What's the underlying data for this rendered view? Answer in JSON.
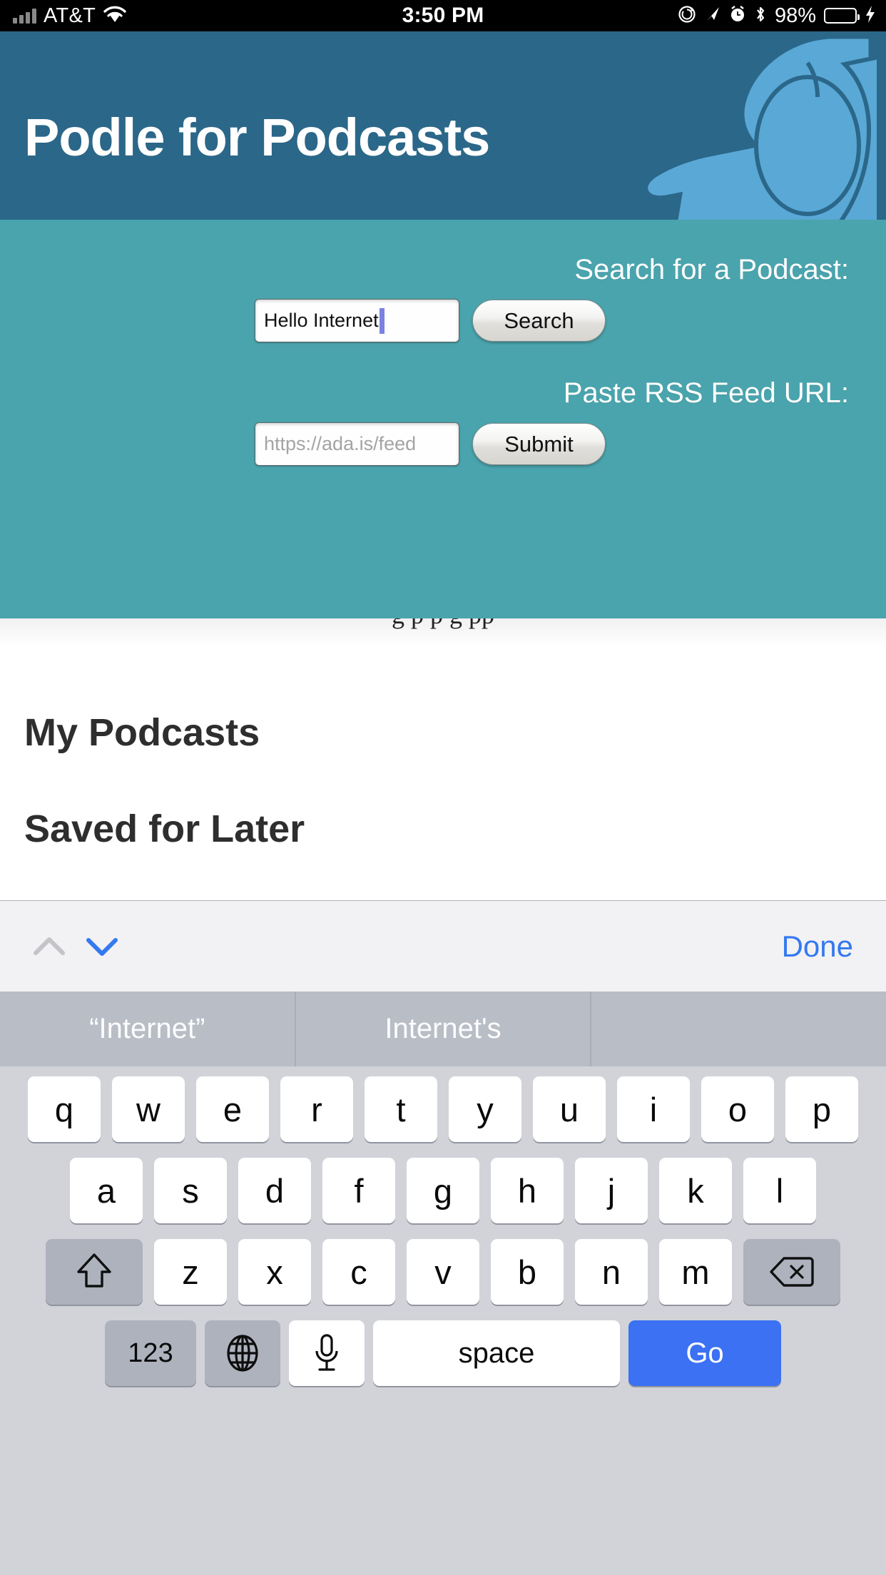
{
  "statusbar": {
    "carrier": "AT&T",
    "time": "3:50 PM",
    "battery_percent": "98%",
    "icons": [
      "signal-bars-icon",
      "wifi-icon",
      "rotation-lock-icon",
      "location-arrow-icon",
      "alarm-clock-icon",
      "bluetooth-icon",
      "battery-icon",
      "charging-bolt-icon"
    ]
  },
  "header": {
    "app_title": "Podle for Podcasts",
    "close_label": "×",
    "background_color": "#2b6789",
    "logo_color": "#5aa8d6",
    "logo_name": "dog-head-logo"
  },
  "search_panel": {
    "background_color": "#4aa4ad",
    "search_label": "Search for a Podcast:",
    "search_value": "Hello Internet",
    "search_button": "Search",
    "rss_label": "Paste RSS Feed URL:",
    "rss_placeholder": "https://ada.is/feed",
    "rss_value": "",
    "submit_button": "Submit"
  },
  "page": {
    "clipped_text": "g   p        p  g           pp",
    "heading_my_podcasts": "My Podcasts",
    "heading_saved_for_later": "Saved for Later"
  },
  "accessory_bar": {
    "prev_icon": "chevron-up-icon",
    "next_icon": "chevron-down-icon",
    "done_label": "Done",
    "accent_color": "#3479f0"
  },
  "suggestions": {
    "items": [
      "“Internet”",
      "Internet's",
      ""
    ]
  },
  "keyboard": {
    "row1": [
      "q",
      "w",
      "e",
      "r",
      "t",
      "y",
      "u",
      "i",
      "o",
      "p"
    ],
    "row2": [
      "a",
      "s",
      "d",
      "f",
      "g",
      "h",
      "j",
      "k",
      "l"
    ],
    "row3": [
      "z",
      "x",
      "c",
      "v",
      "b",
      "n",
      "m"
    ],
    "shift_icon": "shift-arrow-icon",
    "backspace_icon": "backspace-delete-icon",
    "numbers_label": "123",
    "globe_icon": "globe-language-icon",
    "mic_icon": "microphone-icon",
    "space_label": "space",
    "go_label": "Go",
    "go_color": "#3b71f2"
  }
}
